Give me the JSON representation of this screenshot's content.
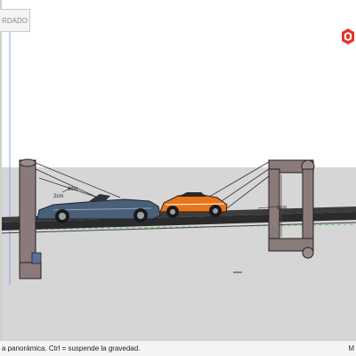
{
  "toolbar": {
    "tab_label": "RDADO"
  },
  "scene": {
    "dim_labels": [
      "8cm",
      "2cm",
      "8cm"
    ],
    "colors": {
      "car_left": "#4a5f78",
      "car_right": "#e8741c",
      "posts": "#8a7a7a",
      "deck": "#2b2b2b"
    }
  },
  "status_bar": {
    "hint": "a panorámica. Ctrl = suspende la gravedad.",
    "right_label": "M"
  },
  "icons": {
    "logo": "sketchup-logo-icon"
  }
}
